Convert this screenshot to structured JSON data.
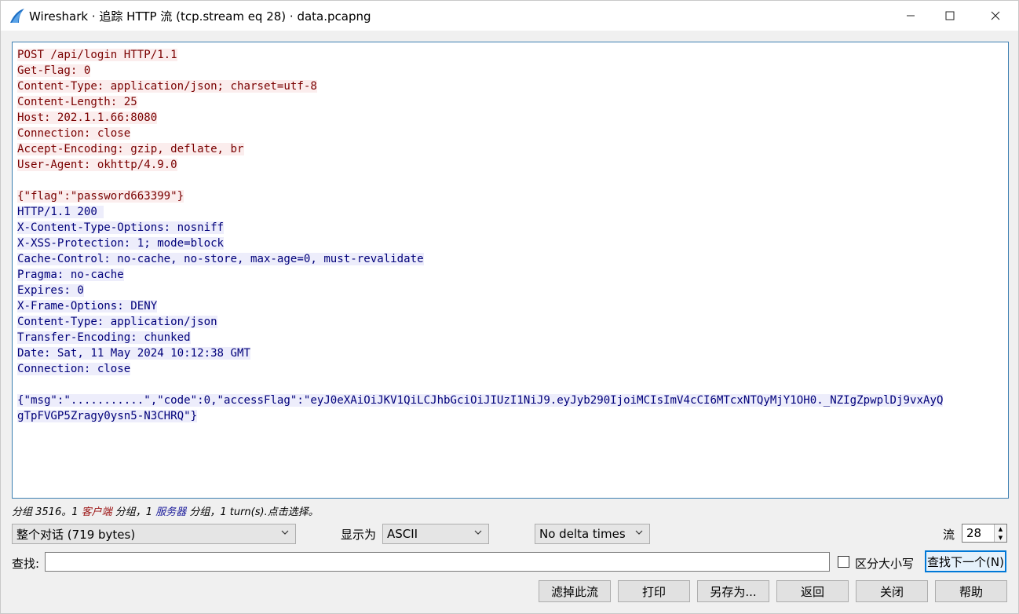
{
  "window": {
    "title": "Wireshark · 追踪 HTTP 流 (tcp.stream eq 28) · data.pcapng",
    "minimize": "—",
    "maximize": "☐",
    "close": "✕"
  },
  "stream": {
    "client_lines": [
      "POST /api/login HTTP/1.1",
      "Get-Flag: 0",
      "Content-Type: application/json; charset=utf-8",
      "Content-Length: 25",
      "Host: 202.1.1.66:8080",
      "Connection: close",
      "Accept-Encoding: gzip, deflate, br",
      "User-Agent: okhttp/4.9.0",
      "",
      "{\"flag\":\"password663399\"}"
    ],
    "server_lines": [
      "HTTP/1.1 200 ",
      "X-Content-Type-Options: nosniff",
      "X-XSS-Protection: 1; mode=block",
      "Cache-Control: no-cache, no-store, max-age=0, must-revalidate",
      "Pragma: no-cache",
      "Expires: 0",
      "X-Frame-Options: DENY",
      "Content-Type: application/json",
      "Transfer-Encoding: chunked",
      "Date: Sat, 11 May 2024 10:12:38 GMT",
      "Connection: close",
      "",
      "{\"msg\":\"...........\",\"code\":0,\"accessFlag\":\"eyJ0eXAiOiJKV1QiLCJhbGciOiJIUzI1NiJ9.eyJyb290IjoiMCIsImV4cCI6MTcxNTQyMjY1OH0._NZIgZpwplDj9vxAyQ",
      "gTpFVGP5Zragy0ysn5-N3CHRQ\"}"
    ],
    "colors": {
      "client_fg": "#7a0000",
      "client_bg": "#fbeded",
      "server_fg": "#00007a",
      "server_bg": "#ededfb"
    }
  },
  "summary": {
    "pre": "分组 3516。1 ",
    "client_word": "客户端",
    "mid": " 分组，1 ",
    "server_word": "服务器",
    "post": " 分组，1 turn(s).点击选择。"
  },
  "controls": {
    "conversation_select": "整个对话 (719 bytes)",
    "show_as_label": "显示为",
    "show_as_select": "ASCII",
    "delta_select": "No delta times",
    "stream_label": "流",
    "stream_value": "28",
    "find_label": "查找:",
    "find_value": "",
    "case_label": "区分大小写",
    "find_next_button": "查找下一个(N)"
  },
  "buttons": {
    "filter_out": "滤掉此流",
    "print": "打印",
    "save_as": "另存为...",
    "back": "返回",
    "close": "关闭",
    "help": "帮助"
  }
}
